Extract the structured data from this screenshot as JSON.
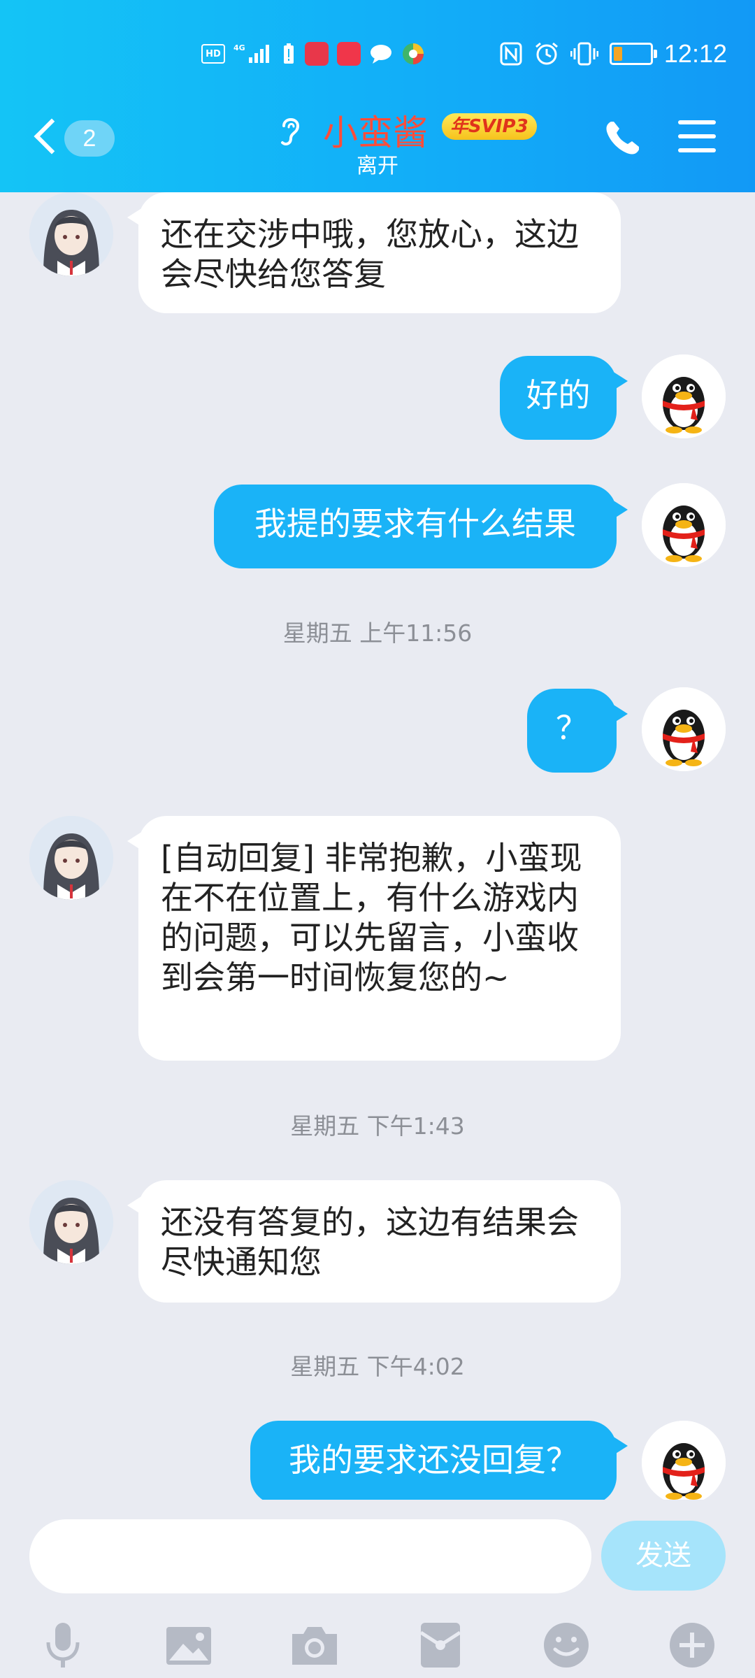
{
  "status_bar": {
    "time": "12:12",
    "battery_percent": 25,
    "left_icons": [
      "hd-icon",
      "4g-signal-icon",
      "battery-alert-icon",
      "huawei-app-icon",
      "shop-app-icon",
      "chat-bubble-icon",
      "browser-icon"
    ],
    "right_icons": [
      "nfc-icon",
      "alarm-icon",
      "vibrate-icon",
      "battery-icon"
    ]
  },
  "header": {
    "unread_count": "2",
    "contact_name": "小蛮酱",
    "svip_badge": "年SVIP3",
    "status": "离开",
    "colors": {
      "start": "#14c4f6",
      "end": "#1299f6",
      "name": "#ff4d3a"
    }
  },
  "messages": [
    {
      "side": "in",
      "text": "还在交涉中哦，您放心，这边会尽快给您答复"
    },
    {
      "side": "out",
      "text": "好的"
    },
    {
      "side": "out",
      "text": "我提的要求有什么结果"
    },
    {
      "type": "time",
      "text": "星期五 上午11:56"
    },
    {
      "side": "out",
      "text": "？"
    },
    {
      "side": "in",
      "text": "[自动回复] 非常抱歉，小蛮现在不在位置上，有什么游戏内的问题，可以先留言，小蛮收到会第一时间恢复您的~"
    },
    {
      "type": "time",
      "text": "星期五 下午1:43"
    },
    {
      "side": "in",
      "text": "还没有答复的，这边有结果会尽快通知您"
    },
    {
      "type": "time",
      "text": "星期五 下午4:02"
    },
    {
      "side": "out",
      "text": "我的要求还没回复？"
    }
  ],
  "input": {
    "placeholder": "",
    "value": "",
    "send_label": "发送"
  },
  "toolbar": [
    "microphone-icon",
    "image-icon",
    "camera-icon",
    "red-packet-icon",
    "emoji-icon",
    "plus-icon"
  ]
}
